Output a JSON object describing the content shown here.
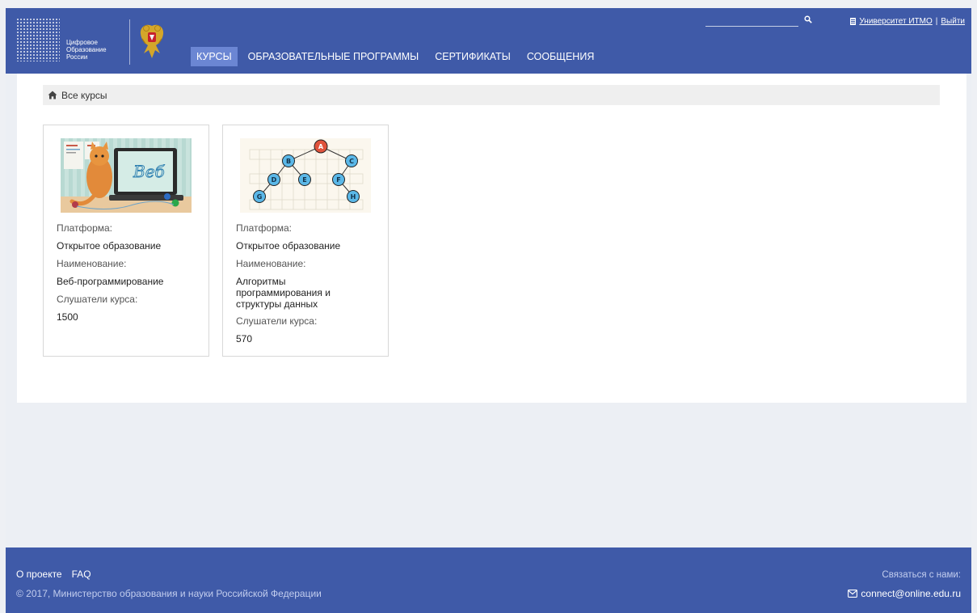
{
  "header": {
    "logo_lines": [
      "Цифровое",
      "Образование",
      "России"
    ],
    "nav": [
      {
        "label": "КУРСЫ",
        "active": true
      },
      {
        "label": "ОБРАЗОВАТЕЛЬНЫЕ ПРОГРАММЫ",
        "active": false
      },
      {
        "label": "СЕРТИФИКАТЫ",
        "active": false
      },
      {
        "label": "СООБЩЕНИЯ",
        "active": false
      }
    ],
    "university_link": "Университет ИТМО",
    "separator": "|",
    "logout_link": "Выйти"
  },
  "breadcrumb": {
    "label": "Все курсы"
  },
  "cards": [
    {
      "platform_label": "Платформа:",
      "platform": "Открытое образование",
      "name_label": "Наименование:",
      "name": "Веб-программирование",
      "listeners_label": "Слушатели курса:",
      "listeners": "1500",
      "image_text": "Веб"
    },
    {
      "platform_label": "Платформа:",
      "platform": "Открытое образование",
      "name_label": "Наименование:",
      "name": "Алгоритмы программирования и структуры данных",
      "listeners_label": "Слушатели курса:",
      "listeners": "570",
      "image_nodes": [
        "A",
        "B",
        "C",
        "D",
        "E",
        "F",
        "G",
        "H"
      ]
    }
  ],
  "footer": {
    "about": "О проекте",
    "faq": "FAQ",
    "copyright": "© 2017, Министерство образования и науки Российской Федерации",
    "contact_label": "Связаться с нами:",
    "email": "connect@online.edu.ru"
  },
  "colors": {
    "brand": "#3f5aa8",
    "nav_active": "#6b86d3",
    "node_red": "#e0533c",
    "node_blue": "#5bb8e8"
  }
}
